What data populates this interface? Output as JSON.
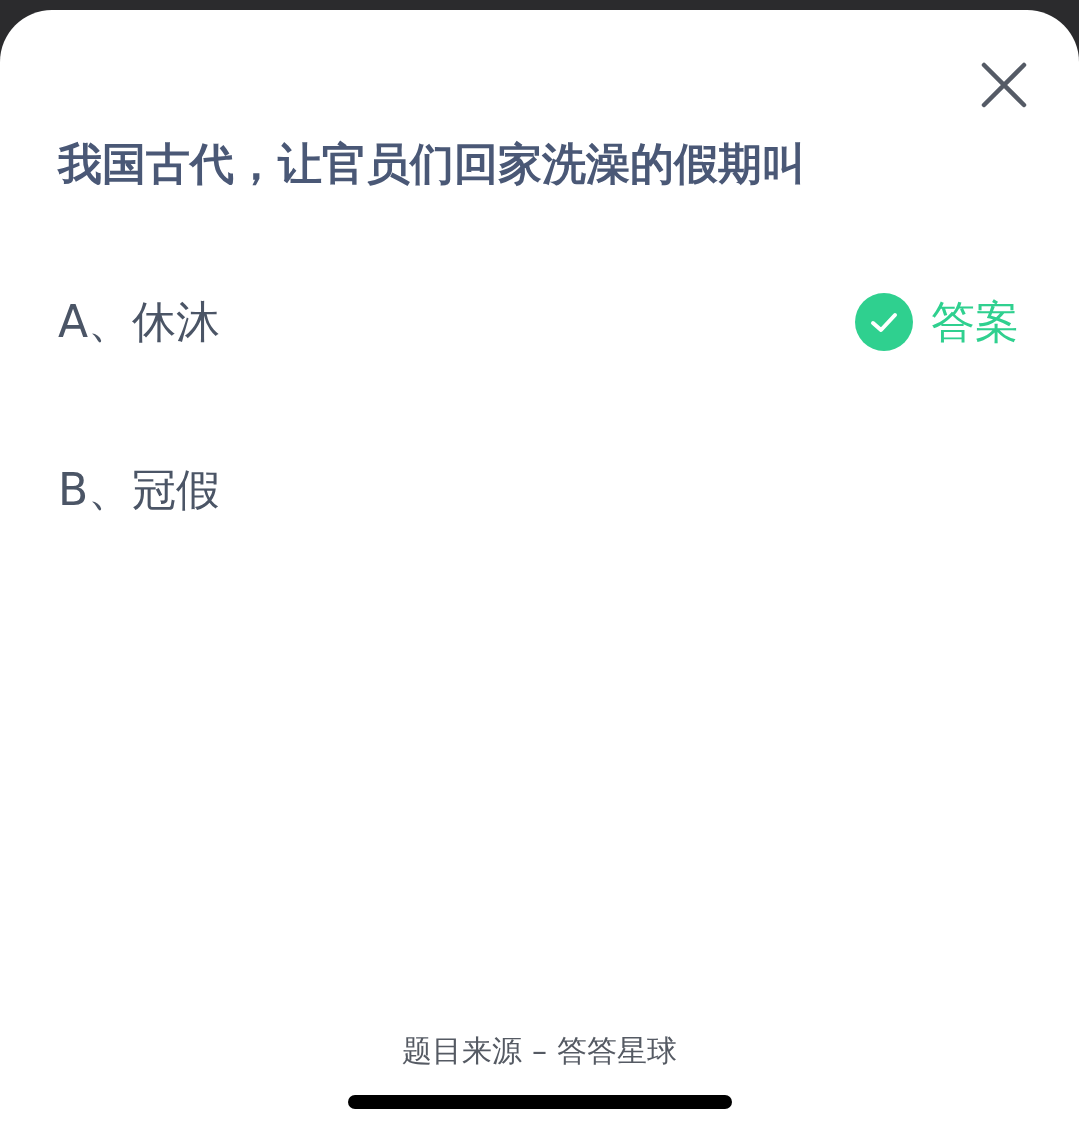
{
  "question": "我国古代，让官员们回家洗澡的假期叫",
  "options": [
    {
      "label": "A、休沐",
      "correct": true
    },
    {
      "label": "B、冠假",
      "correct": false
    }
  ],
  "answer_label": "答案",
  "footer": "题目来源 – 答答星球"
}
